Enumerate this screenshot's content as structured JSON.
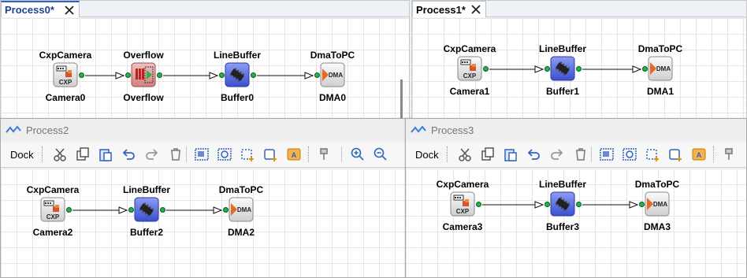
{
  "panes": {
    "p0": {
      "tab": "Process0*"
    },
    "p1": {
      "tab": "Process1*"
    },
    "p2": {
      "title": "Process2"
    },
    "p3": {
      "title": "Process3"
    }
  },
  "toolbar": {
    "dock": "Dock",
    "icons": [
      "cut-icon",
      "copy-icon",
      "paste-icon",
      "undo-icon",
      "redo-icon",
      "delete-icon",
      "group-icon",
      "ungroup-icon",
      "select-add-icon",
      "add-link-icon",
      "annotation-icon",
      "pin-icon",
      "zoom-in-icon",
      "zoom-out-icon"
    ]
  },
  "diagrams": {
    "p0": [
      {
        "type": "CxpCamera",
        "name": "Camera0",
        "icon": "camera"
      },
      {
        "type": "Overflow",
        "name": "Overflow",
        "icon": "overflow"
      },
      {
        "type": "LineBuffer",
        "name": "Buffer0",
        "icon": "buffer"
      },
      {
        "type": "DmaToPC",
        "name": "DMA0",
        "icon": "dma"
      }
    ],
    "p1": [
      {
        "type": "CxpCamera",
        "name": "Camera1",
        "icon": "camera"
      },
      {
        "type": "LineBuffer",
        "name": "Buffer1",
        "icon": "buffer"
      },
      {
        "type": "DmaToPC",
        "name": "DMA1",
        "icon": "dma"
      }
    ],
    "p2": [
      {
        "type": "CxpCamera",
        "name": "Camera2",
        "icon": "camera"
      },
      {
        "type": "LineBuffer",
        "name": "Buffer2",
        "icon": "buffer"
      },
      {
        "type": "DmaToPC",
        "name": "DMA2",
        "icon": "dma"
      }
    ],
    "p3": [
      {
        "type": "CxpCamera",
        "name": "Camera3",
        "icon": "camera"
      },
      {
        "type": "LineBuffer",
        "name": "Buffer3",
        "icon": "buffer"
      },
      {
        "type": "DmaToPC",
        "name": "DMA3",
        "icon": "dma"
      }
    ]
  },
  "icon_text": {
    "camera": "CXP",
    "dma": "DMA"
  },
  "colors": {
    "accent": "#2f64c0",
    "port": "#22b24c",
    "buffer": "#5a6ee0",
    "overflow": "#d98a8a"
  }
}
